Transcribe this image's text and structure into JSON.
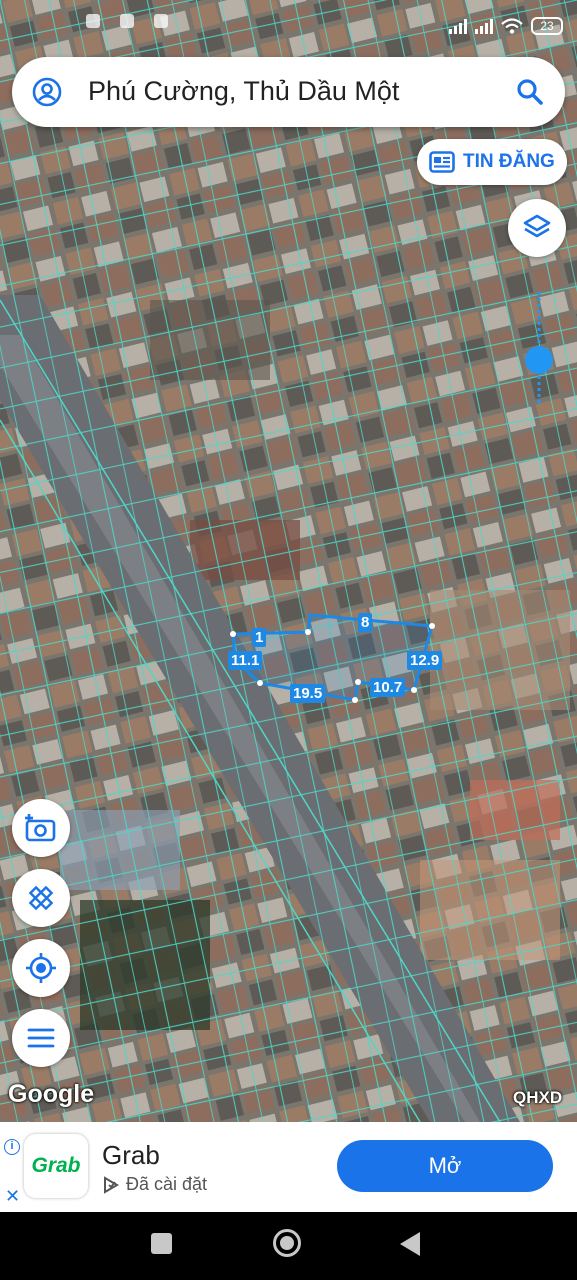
{
  "status_bar": {
    "battery": "23"
  },
  "search": {
    "title": "Phú Cường, Thủ Dầu Một",
    "account_icon": "account-circle-icon",
    "search_icon": "search-icon"
  },
  "tin_dang": {
    "label": "TIN ĐĂNG",
    "icon": "newspaper-icon"
  },
  "map_controls": {
    "layers_icon": "layers-icon",
    "camera_icon": "add-photo-icon",
    "measure_icon": "ruler-pencil-icon",
    "location_icon": "my-location-icon",
    "menu_icon": "menu-icon"
  },
  "measurements": {
    "top": "1",
    "left": "11.1",
    "bottom": "19.5",
    "bottom_right": "10.7",
    "right": "12.9",
    "top_right": "8"
  },
  "attribution": {
    "google": "Google",
    "layer_name": "QHXD"
  },
  "ad": {
    "app_name": "Grab",
    "logo_text": "Grab",
    "status": "Đã cài đặt",
    "open_label": "Mở",
    "info_symbol": "i",
    "close_symbol": "✕"
  },
  "colors": {
    "accent": "#1a73e8",
    "parcel_lines": "#4fd6c8",
    "grab_green": "#00b14f",
    "measure_blue": "#1e88e5"
  }
}
